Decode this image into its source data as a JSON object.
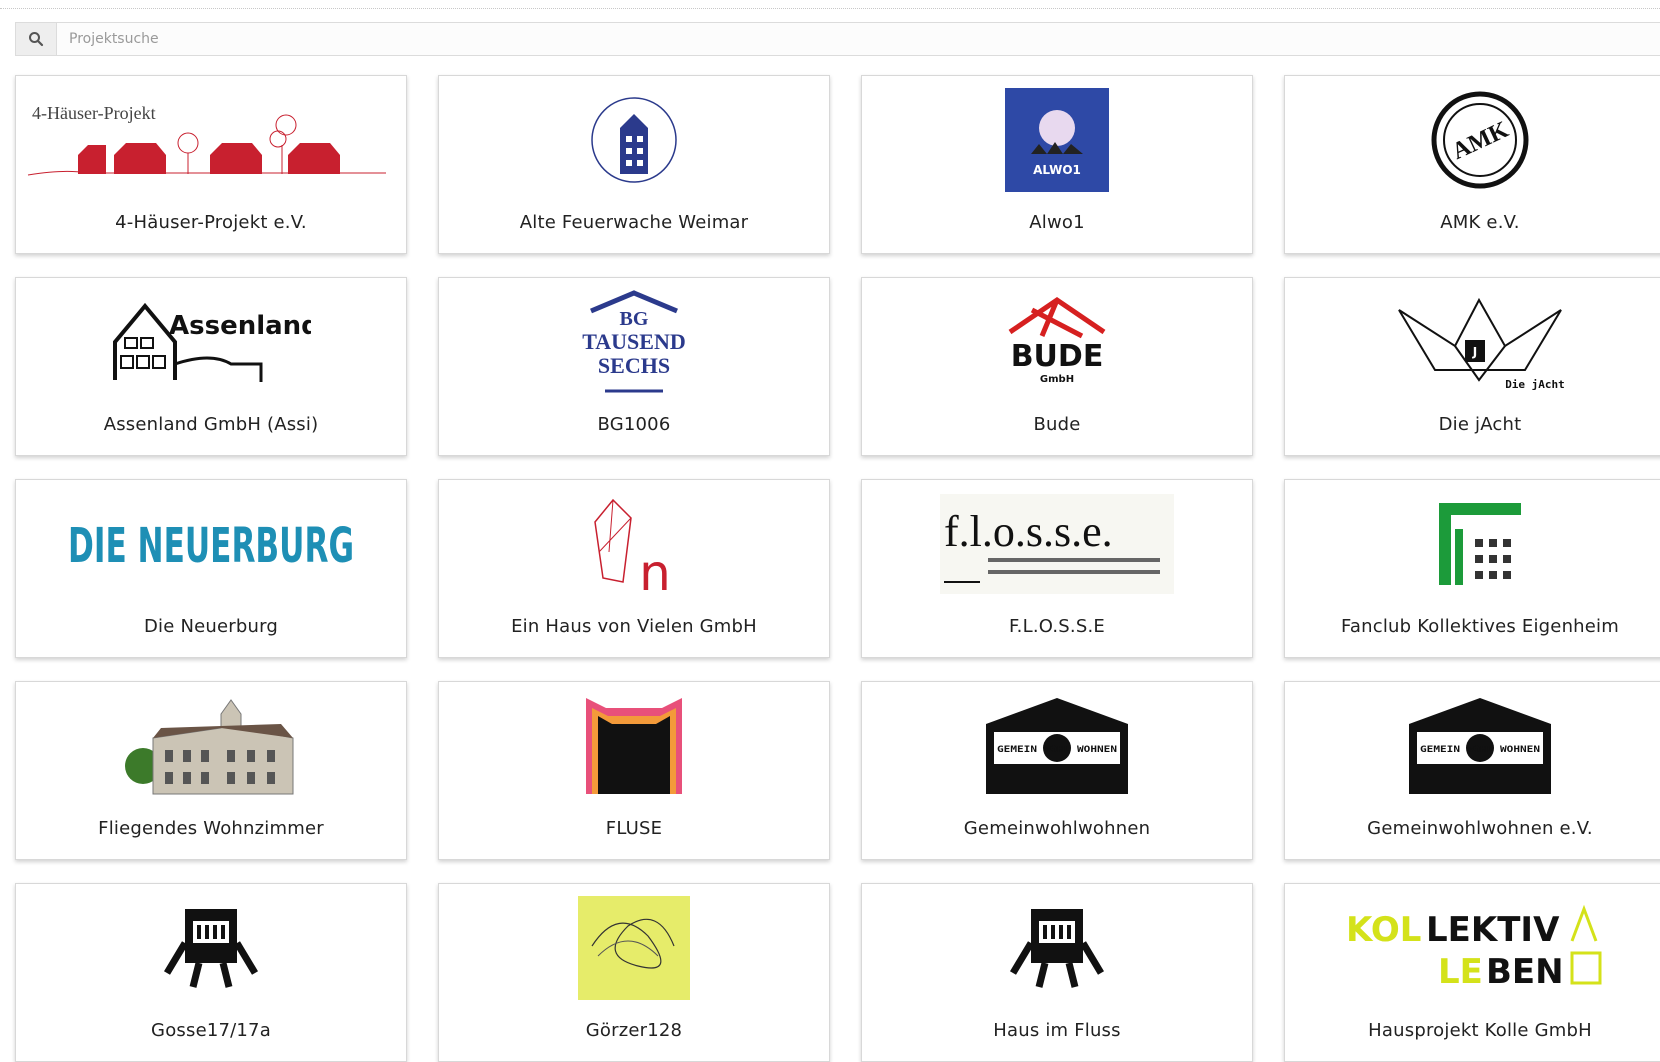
{
  "search": {
    "placeholder": "Projektsuche"
  },
  "projects": [
    {
      "name": "4-Häuser-Projekt e.V.",
      "logo_text": "4-Häuser-Projekt"
    },
    {
      "name": "Alte Feuerwache Weimar",
      "logo_text": "Alte Feuerwache Weimar"
    },
    {
      "name": "Alwo1",
      "logo_text": "ALWO1"
    },
    {
      "name": "AMK e.V.",
      "logo_text": "AMK"
    },
    {
      "name": "Assenland GmbH (Assi)",
      "logo_text": "Assenland"
    },
    {
      "name": "BG1006",
      "logo_text": "BG TAUSEND SECHS"
    },
    {
      "name": "Bude",
      "logo_text": "BUDE"
    },
    {
      "name": "Die jAcht",
      "logo_text": "Die jAcht"
    },
    {
      "name": "Die Neuerburg",
      "logo_text": "DIE NEUERBURG"
    },
    {
      "name": "Ein Haus von Vielen GmbH",
      "logo_text": "n"
    },
    {
      "name": "F.L.O.S.S.E",
      "logo_text": "f.l.o.s.s.e."
    },
    {
      "name": "Fanclub Kollektives Eigenheim",
      "logo_text": ""
    },
    {
      "name": "Fliegendes Wohnzimmer",
      "logo_text": ""
    },
    {
      "name": "FLUSE",
      "logo_text": ""
    },
    {
      "name": "Gemeinwohlwohnen",
      "logo_text": "GEMEIN WOHL WOHNEN"
    },
    {
      "name": "Gemeinwohlwohnen e.V.",
      "logo_text": "GEMEIN WOHL WOHNEN"
    },
    {
      "name": "Gosse17/17a",
      "logo_text": ""
    },
    {
      "name": "Görzer128",
      "logo_text": ""
    },
    {
      "name": "Haus im Fluss",
      "logo_text": ""
    },
    {
      "name": "Hausprojekt Kolle GmbH",
      "logo_text": "KOLLEKTIV LEBEN"
    }
  ],
  "colors": {
    "red": "#c8202f",
    "navy": "#2b3a8c",
    "teal": "#1e8fb5",
    "green": "#1c9b3a",
    "lime": "#d4e21a",
    "alwo_blue": "#2e49a6"
  }
}
